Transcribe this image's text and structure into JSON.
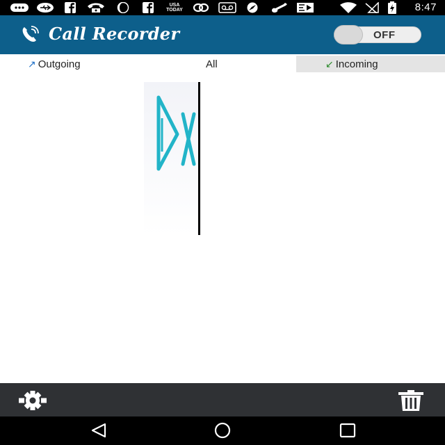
{
  "status_bar": {
    "time": "8:47",
    "icons": [
      "messaging-icon",
      "usb-icon",
      "facebook-icon",
      "phone-icon",
      "moon-icon",
      "facebook-icon",
      "usa-today-icon",
      "link-icon",
      "voicemail-icon",
      "compass-icon",
      "guitar-icon",
      "media-icon",
      "wifi-icon",
      "no-signal-icon",
      "battery-charging-icon"
    ],
    "usa_today_top": "USA",
    "usa_today_bottom": "TODAY"
  },
  "app_bar": {
    "title": "Call Recorder",
    "toggle_label": "OFF",
    "toggle_state": "off",
    "color": "#0d5f8b"
  },
  "tabs": {
    "outgoing_label": "Outgoing",
    "all_label": "All",
    "incoming_label": "Incoming",
    "selected": "incoming"
  },
  "toolbar": {
    "settings_icon": "gear-icon",
    "delete_icon": "trash-icon",
    "color": "#2f3134"
  },
  "nav_bar": {
    "icons": [
      "back-icon",
      "home-icon",
      "recents-icon"
    ]
  }
}
